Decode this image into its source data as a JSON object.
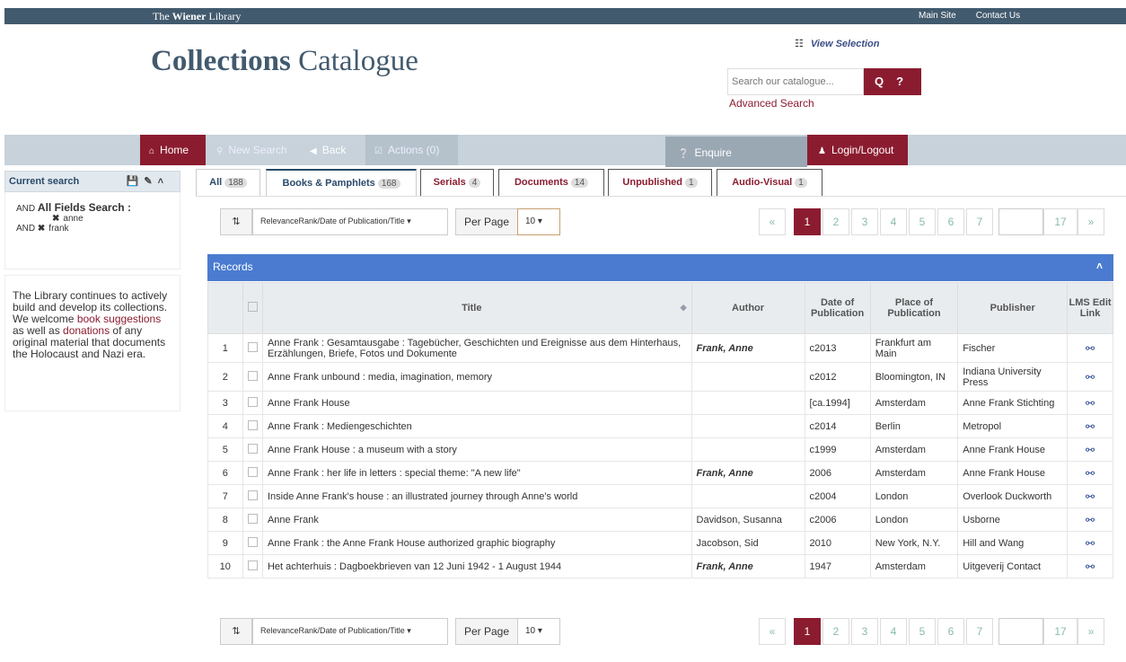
{
  "topbar": {
    "brand_a": "The ",
    "brand_b": "Wiener",
    "brand_c": " Library",
    "main_site": "Main Site",
    "contact": "Contact Us"
  },
  "header": {
    "title_bold": "Collections",
    "title_rest": " Catalogue",
    "view_selection": "View Selection",
    "search_placeholder": "Search our catalogue...",
    "search_icon": "Q",
    "help": "?",
    "advanced": "Advanced Search"
  },
  "nav": {
    "home": "Home",
    "new_search": "New Search",
    "back": "Back",
    "actions": "Actions (0)",
    "enquire": "Enquire",
    "login": "Login/Logout"
  },
  "sidebar": {
    "current_search": "Current search",
    "and1": "AND ",
    "field": "All Fields Search :",
    "term1": "anne",
    "and2": "AND ",
    "term2": "frank",
    "msg_a": "The Library continues to actively build and develop its collections. We welcome ",
    "msg_link1": "book suggestions",
    "msg_b": " as well as ",
    "msg_link2": "donations",
    "msg_c": "  of any original material that documents the Holocaust and Nazi era."
  },
  "tabs": [
    {
      "label": "All",
      "count": "188"
    },
    {
      "label": "Books & Pamphlets",
      "count": "168"
    },
    {
      "label": "Serials",
      "count": "4"
    },
    {
      "label": "Documents",
      "count": "14"
    },
    {
      "label": "Unpublished",
      "count": "1"
    },
    {
      "label": "Audio-Visual",
      "count": "1"
    }
  ],
  "controls": {
    "sort": "RelevanceRank/Date of Publication/Title",
    "per_page_label": "Per Page",
    "per_page": "10"
  },
  "pager": {
    "prev": "«",
    "next": "»",
    "pages": [
      "1",
      "2",
      "3",
      "4",
      "5",
      "6",
      "7"
    ],
    "last": "17"
  },
  "records": {
    "title": "Records",
    "headers": {
      "title": "Title",
      "author": "Author",
      "date": "Date of Publication",
      "place": "Place of Publication",
      "publisher": "Publisher",
      "lms": "LMS Edit Link"
    },
    "rows": [
      {
        "n": "1",
        "title": "Anne Frank : Gesamtausgabe : Tagebücher, Geschichten und Ereignisse aus dem Hinterhaus, Erzählungen, Briefe, Fotos und Dokumente",
        "author": "Frank, Anne",
        "date": "c2013",
        "place": "Frankfurt am Main",
        "pub": "Fischer"
      },
      {
        "n": "2",
        "title": "Anne Frank unbound : media, imagination, memory",
        "author": "",
        "date": "c2012",
        "place": "Bloomington, IN",
        "pub": "Indiana University Press"
      },
      {
        "n": "3",
        "title": "Anne Frank House",
        "author": "",
        "date": "[ca.1994]",
        "place": "Amsterdam",
        "pub": "Anne Frank Stichting"
      },
      {
        "n": "4",
        "title": "Anne Frank : Mediengeschichten",
        "author": "",
        "date": "c2014",
        "place": "Berlin",
        "pub": "Metropol"
      },
      {
        "n": "5",
        "title": "Anne Frank House : a museum with a story",
        "author": "",
        "date": "c1999",
        "place": "Amsterdam",
        "pub": "Anne Frank House"
      },
      {
        "n": "6",
        "title": "Anne Frank : her life in letters : special theme: \"A new life\"",
        "author": "Frank, Anne",
        "date": "2006",
        "place": "Amsterdam",
        "pub": "Anne Frank House"
      },
      {
        "n": "7",
        "title": "Inside Anne Frank's house : an illustrated journey through Anne's world",
        "author": "",
        "date": "c2004",
        "place": "London",
        "pub": "Overlook Duckworth"
      },
      {
        "n": "8",
        "title": "Anne Frank",
        "author": "Davidson, Susanna",
        "date": "c2006",
        "place": "London",
        "pub": "Usborne"
      },
      {
        "n": "9",
        "title": "Anne Frank : the Anne Frank House authorized graphic biography",
        "author": "Jacobson, Sid",
        "date": "2010",
        "place": "New York, N.Y.",
        "pub": "Hill and Wang"
      },
      {
        "n": "10",
        "title": "Het achterhuis : Dagboekbrieven van 12 Juni 1942 - 1 August 1944",
        "author": "Frank, Anne",
        "date": "1947",
        "place": "Amsterdam",
        "pub": "Uitgeverij Contact"
      }
    ]
  }
}
